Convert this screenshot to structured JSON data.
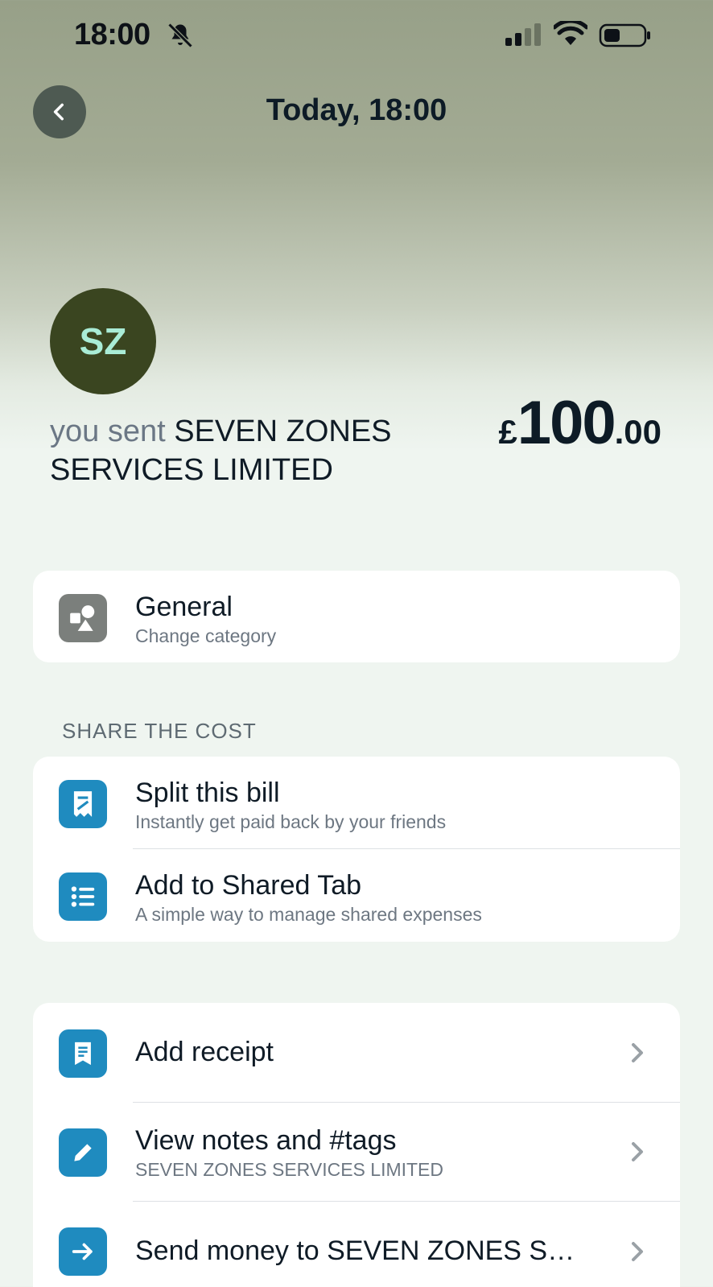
{
  "status_bar": {
    "time": "18:00",
    "icons": [
      "bell-slash-icon",
      "signal-icon",
      "wifi-icon",
      "battery-icon"
    ]
  },
  "header": {
    "title": "Today, 18:00",
    "back_icon": "chevron-left-icon"
  },
  "transaction": {
    "avatar_initials": "SZ",
    "prefix": "you sent",
    "merchant": "SEVEN ZONES SERVICES LIMITED",
    "amount_currency": "£",
    "amount_whole": "100",
    "amount_decimal": ".00"
  },
  "category": {
    "title": "General",
    "subtitle": "Change category",
    "icon": "shapes-icon"
  },
  "share": {
    "section_label": "SHARE THE COST",
    "items": [
      {
        "title": "Split this bill",
        "subtitle": "Instantly get paid back by your friends",
        "icon": "split-bill-icon"
      },
      {
        "title": "Add to Shared Tab",
        "subtitle": "A simple way to manage shared expenses",
        "icon": "list-icon"
      }
    ]
  },
  "actions": {
    "items": [
      {
        "title": "Add receipt",
        "icon": "receipt-icon"
      },
      {
        "title": "View notes and #tags",
        "subtitle": "SEVEN ZONES SERVICES LIMITED",
        "icon": "pencil-icon"
      },
      {
        "title": "Send money to SEVEN ZONES S…",
        "icon": "arrow-right-icon"
      }
    ]
  },
  "colors": {
    "accent_blue": "#1f8bbf",
    "avatar_bg": "#3a4520",
    "avatar_text": "#a9ecd6",
    "category_icon_bg": "#7b7f7c"
  }
}
